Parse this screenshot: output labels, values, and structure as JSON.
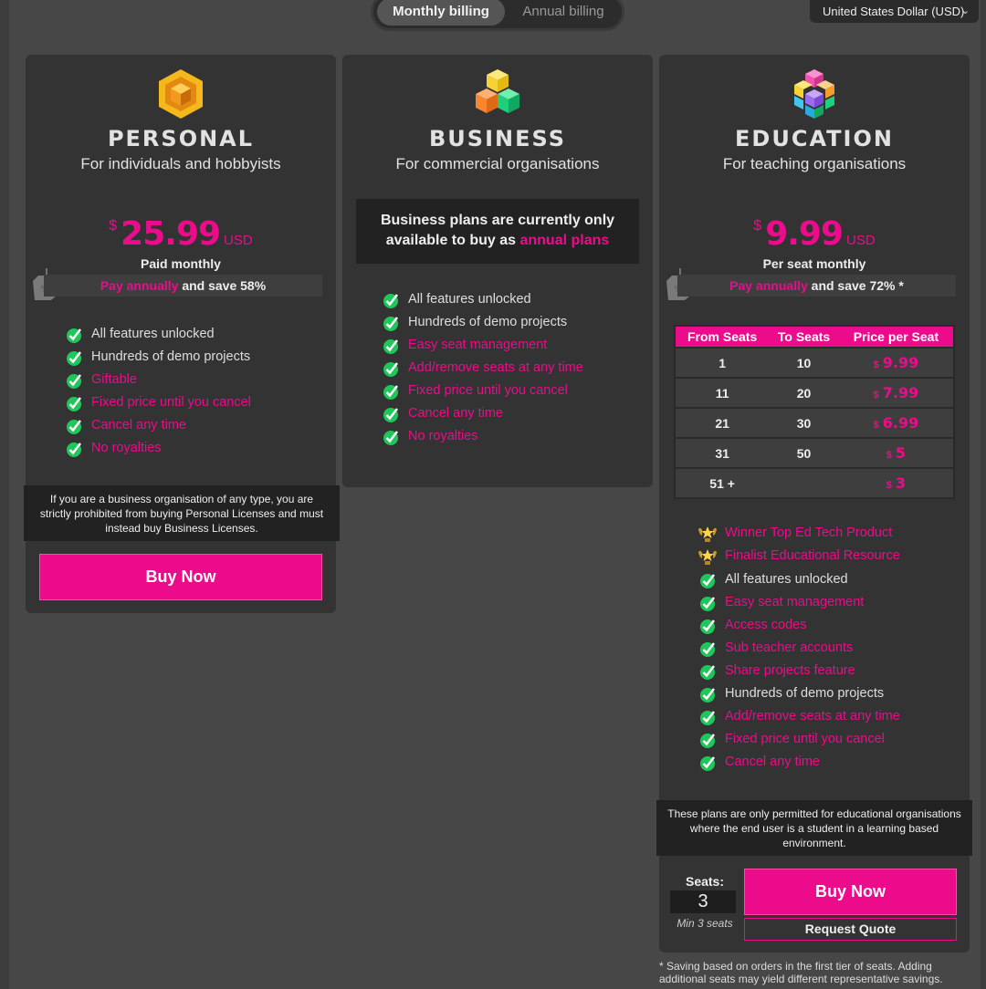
{
  "billing_toggle": {
    "monthly": "Monthly billing",
    "annual": "Annual billing",
    "selected": "monthly"
  },
  "currency": {
    "selected": "United States Dollar (USD)"
  },
  "colors": {
    "accent": "#ec0b8b",
    "card": "#333333",
    "background": "#474747"
  },
  "personal": {
    "name": "PERSONAL",
    "subtitle": "For individuals and hobbyists",
    "price": {
      "currency_symbol": "$",
      "amount": "25.99",
      "unit": "USD"
    },
    "period": "Paid monthly",
    "save": {
      "link": "Pay annually",
      "text": "and save 58%"
    },
    "features": [
      {
        "label": "All features unlocked",
        "highlight": false
      },
      {
        "label": "Hundreds of demo projects",
        "highlight": false
      },
      {
        "label": "Giftable",
        "highlight": true
      },
      {
        "label": "Fixed price until you cancel",
        "highlight": true
      },
      {
        "label": "Cancel any time",
        "highlight": true
      },
      {
        "label": "No royalties",
        "highlight": true
      }
    ],
    "warning": "If you are a business organisation of any type, you are strictly prohibited from buying Personal Licenses and must instead buy Business Licenses.",
    "buy_label": "Buy Now"
  },
  "business": {
    "name": "BUSINESS",
    "subtitle": "For commercial organisations",
    "note_text": "Business plans are currently only available to buy as",
    "note_link": "annual plans",
    "features": [
      {
        "label": "All features unlocked",
        "highlight": false
      },
      {
        "label": "Hundreds of demo projects",
        "highlight": false
      },
      {
        "label": "Easy seat management",
        "highlight": true
      },
      {
        "label": "Add/remove seats at any time",
        "highlight": true
      },
      {
        "label": "Fixed price until you cancel",
        "highlight": true
      },
      {
        "label": "Cancel any time",
        "highlight": true
      },
      {
        "label": "No royalties",
        "highlight": true
      }
    ]
  },
  "education": {
    "name": "EDUCATION",
    "subtitle": "For teaching organisations",
    "price": {
      "currency_symbol": "$",
      "amount": "9.99",
      "unit": "USD"
    },
    "period": "Per seat monthly",
    "save": {
      "link": "Pay annually",
      "text": "and save 72% *"
    },
    "table": {
      "headers": [
        "From Seats",
        "To Seats",
        "Price per Seat"
      ],
      "rows": [
        {
          "from": "1",
          "to": "10",
          "currency_symbol": "$",
          "price": "9.99"
        },
        {
          "from": "11",
          "to": "20",
          "currency_symbol": "$",
          "price": "7.99"
        },
        {
          "from": "21",
          "to": "30",
          "currency_symbol": "$",
          "price": "6.99"
        },
        {
          "from": "31",
          "to": "50",
          "currency_symbol": "$",
          "price": "5"
        },
        {
          "from": "51 +",
          "to": "",
          "currency_symbol": "$",
          "price": "3"
        }
      ]
    },
    "awards": [
      {
        "label": "Winner Top Ed Tech Product",
        "icon": "trophy-icon"
      },
      {
        "label": "Finalist Educational Resource",
        "icon": "trophy-icon"
      }
    ],
    "features": [
      {
        "label": "All features unlocked",
        "highlight": false
      },
      {
        "label": "Easy seat management",
        "highlight": true
      },
      {
        "label": "Access codes",
        "highlight": true
      },
      {
        "label": "Sub teacher accounts",
        "highlight": true
      },
      {
        "label": "Share projects feature",
        "highlight": true
      },
      {
        "label": "Hundreds of demo projects",
        "highlight": false
      },
      {
        "label": "Add/remove seats at any time",
        "highlight": true
      },
      {
        "label": "Fixed price until you cancel",
        "highlight": true
      },
      {
        "label": "Cancel any time",
        "highlight": true
      }
    ],
    "warning": "These plans are only permitted for educational organisations where the end user is a student in a learning based environment.",
    "seats_label": "Seats:",
    "seats_value": "3",
    "seats_min": "Min 3 seats",
    "buy_label": "Buy Now",
    "quote_label": "Request Quote",
    "footnote": "* Saving based on orders in the first tier of seats. Adding additional seats may yield different representative savings."
  }
}
